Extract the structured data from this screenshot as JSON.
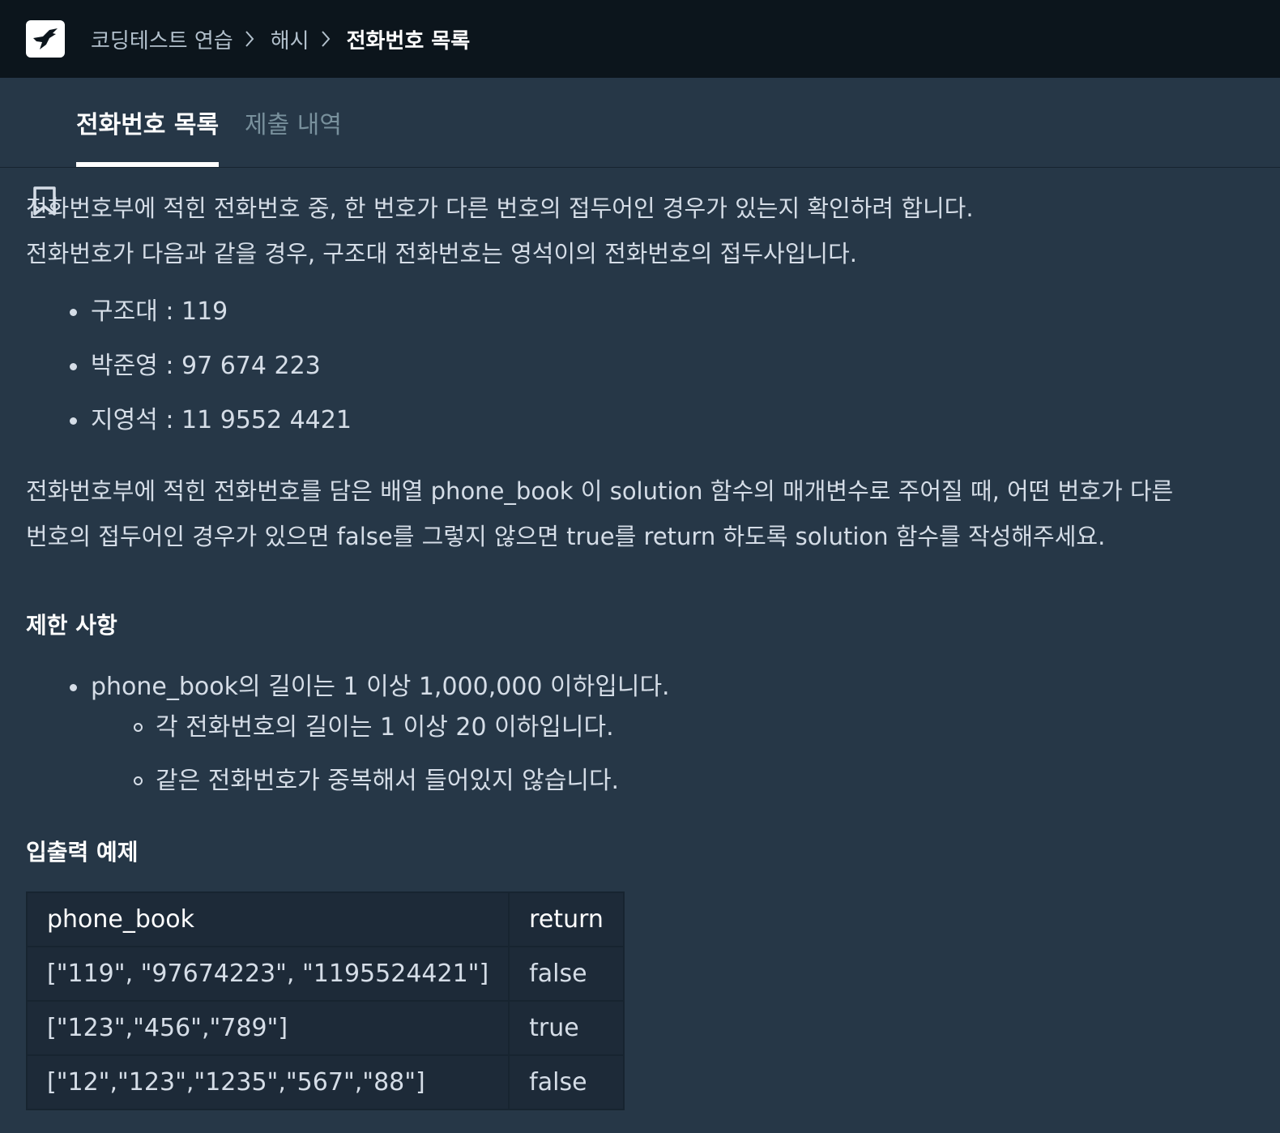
{
  "header": {
    "breadcrumb": [
      "코딩테스트 연습",
      "해시",
      "전화번호 목록"
    ]
  },
  "tabs": [
    {
      "label": "전화번호 목록",
      "active": true
    },
    {
      "label": "제출 내역",
      "active": false
    }
  ],
  "problem": {
    "intro": [
      "전화번호부에 적힌 전화번호 중, 한 번호가 다른 번호의 접두어인 경우가 있는지 확인하려 합니다.",
      "전화번호가 다음과 같을 경우, 구조대 전화번호는 영석이의 전화번호의 접두사입니다."
    ],
    "examples_list": [
      "구조대 : 119",
      "박준영 : 97 674 223",
      "지영석 : 11 9552 4421"
    ],
    "task": [
      "전화번호부에 적힌 전화번호를 담은 배열 phone_book 이 solution 함수의 매개변수로 주어질 때, 어떤 번호가 다른",
      "번호의 접두어인 경우가 있으면 false를 그렇지 않으면 true를 return 하도록 solution 함수를 작성해주세요."
    ],
    "constraints_title": "제한 사항",
    "constraint_main": "phone_book의 길이는 1 이상 1,000,000 이하입니다.",
    "constraint_subs": [
      "각 전화번호의 길이는 1 이상 20 이하입니다.",
      "같은 전화번호가 중복해서 들어있지 않습니다."
    ],
    "io_title": "입출력 예제",
    "io_table": {
      "headers": [
        "phone_book",
        "return"
      ],
      "rows": [
        [
          "[\"119\", \"97674223\", \"1195524421\"]",
          "false"
        ],
        [
          "[\"123\",\"456\",\"789\"]",
          "true"
        ],
        [
          "[\"12\",\"123\",\"1235\",\"567\",\"88\"]",
          "false"
        ]
      ]
    }
  },
  "colors": {
    "topbar_bg": "#0c151c",
    "content_bg": "#263747",
    "table_bg": "#1d2a38",
    "text": "#d5dde7",
    "inactive_tab": "#78909c"
  },
  "icons": {
    "logo": "hummingbird-logo-icon",
    "separator": "chevron-right-icon",
    "tab": "bookmark-icon"
  }
}
